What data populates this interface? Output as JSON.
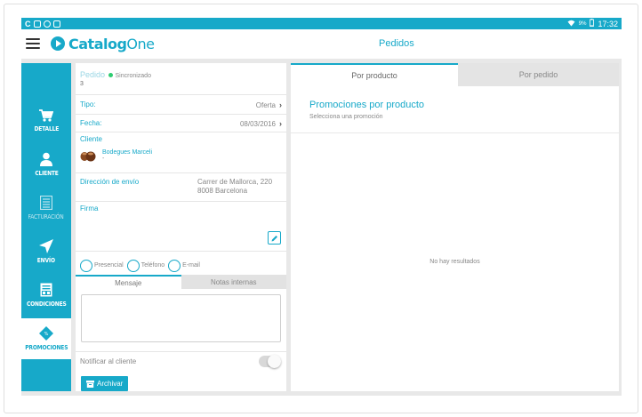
{
  "status_bar": {
    "time": "17:32",
    "battery": "9%",
    "left_icons": [
      "c-icon",
      "square-icon",
      "circle-icon",
      "image-icon"
    ]
  },
  "app": {
    "brand_prefix": "Catalog",
    "brand_suffix": "One",
    "title": "Pedidos"
  },
  "colors": {
    "accent": "#17a9c9",
    "background": "#e8e8e8"
  },
  "sidebar": {
    "items": [
      {
        "label": "DETALLE",
        "icon": "cart-icon",
        "state": "normal"
      },
      {
        "label": "CLIENTE",
        "icon": "person-icon",
        "state": "normal"
      },
      {
        "label": "FACTURACIÓN",
        "icon": "document-icon",
        "state": "disabled"
      },
      {
        "label": "ENVÍO",
        "icon": "send-icon",
        "state": "normal"
      },
      {
        "label": "CONDICIONES",
        "icon": "clipboard-icon",
        "state": "normal"
      },
      {
        "label": "PROMOCIONES",
        "icon": "tag-icon",
        "state": "active"
      }
    ]
  },
  "order": {
    "header_label": "Pedido",
    "sync_status": "Sincronizado",
    "number": "3",
    "tipo_label": "Tipo:",
    "tipo_value": "Oferta",
    "fecha_label": "Fecha:",
    "fecha_value": "08/03/2016",
    "cliente_label": "Cliente",
    "cliente_name": "Bodegues Marceli",
    "cliente_sub": "-",
    "direccion_label": "Dirección de envío",
    "direccion_line1": "Carrer de Mallorca, 220",
    "direccion_line2": "8008 Barcelona",
    "firma_label": "Firma",
    "contact_options": [
      "Presencial",
      "Teléfono",
      "E-mail"
    ],
    "tabs": [
      "Mensaje",
      "Notas internas"
    ],
    "notify_label": "Notificar al cliente",
    "archive_label": "Archivar"
  },
  "promotions": {
    "tabs": [
      "Por producto",
      "Por pedido"
    ],
    "title": "Promociones por producto",
    "subtitle": "Selecciona una promoción",
    "empty_text": "No hay resultados"
  }
}
